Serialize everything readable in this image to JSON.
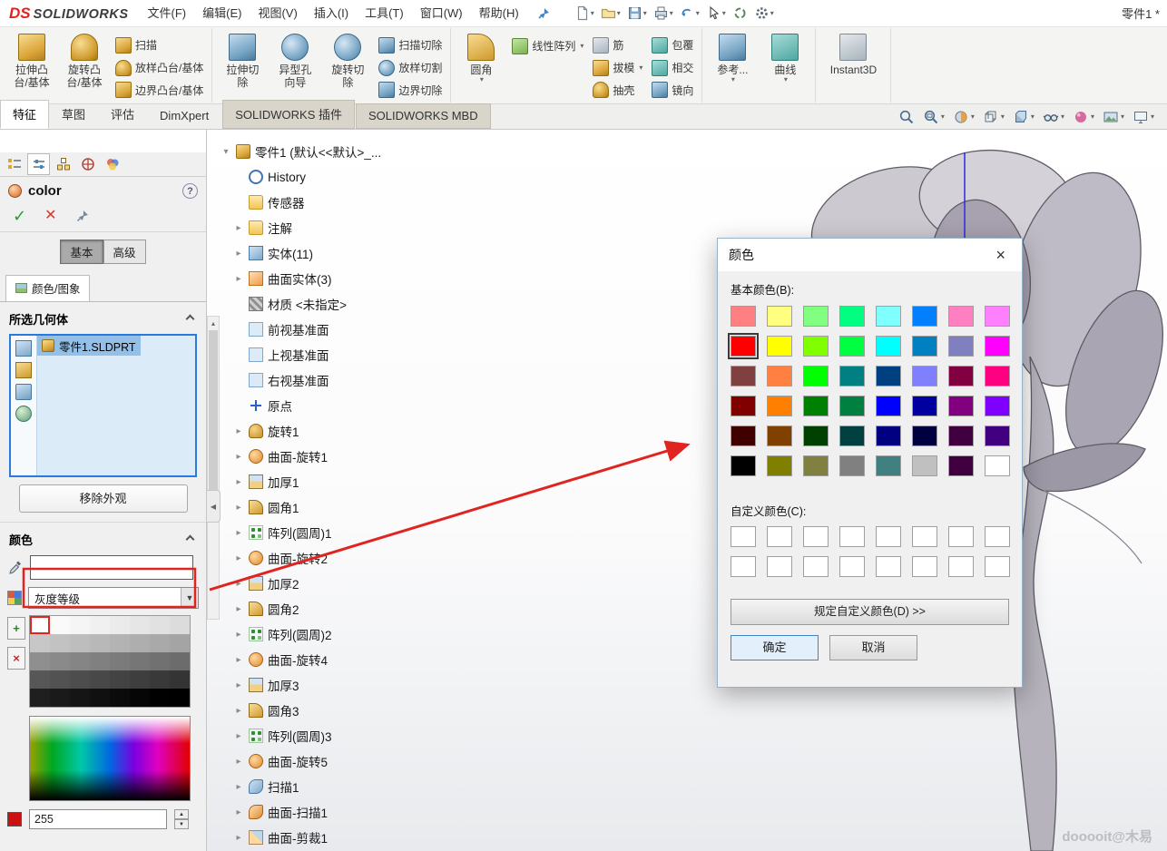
{
  "app": {
    "logo_ds": "DS",
    "logo_name": "SOLIDWORKS",
    "doc_title": "零件1 *",
    "watermark": "dooooit@木易"
  },
  "colors": {
    "annotation_red": "#e02420",
    "selection_blue": "#2a7ade",
    "logo_red": "#e2231a"
  },
  "icons": {
    "caret_down": "▾",
    "expander": "▸",
    "check": "✓",
    "cross": "✕",
    "close": "×",
    "help": "?",
    "collapse_left": "◀",
    "spin_up": "▲",
    "spin_down": "▼",
    "scroll_up": "▴",
    "plus": "+",
    "delete": "×"
  },
  "menubar": {
    "items": [
      "文件(F)",
      "编辑(E)",
      "视图(V)",
      "插入(I)",
      "工具(T)",
      "窗口(W)",
      "帮助(H)"
    ]
  },
  "ribbon": {
    "g1_big": [
      [
        "拉伸凸",
        "台/基体"
      ],
      [
        "旋转凸",
        "台/基体"
      ]
    ],
    "g1_small": [
      "扫描",
      "放样凸台/基体",
      "边界凸台/基体"
    ],
    "g2_big": [
      [
        "拉伸切",
        "除"
      ],
      [
        "异型孔",
        "向导"
      ],
      [
        "旋转切",
        "除"
      ]
    ],
    "g2_small": [
      "扫描切除",
      "放样切割",
      "边界切除"
    ],
    "g3_big": [
      [
        "圆角",
        ""
      ]
    ],
    "g3_small1": [
      "线性阵列"
    ],
    "g3_small2": [
      "筋",
      "拔模",
      "抽壳"
    ],
    "g3_small3": [
      "包覆",
      "相交",
      "镜向"
    ],
    "g4_big": [
      [
        "参考...",
        ""
      ],
      [
        "曲线",
        ""
      ]
    ],
    "g5_big": [
      [
        "Instant3D",
        ""
      ]
    ]
  },
  "tabs": {
    "items": [
      "特征",
      "草图",
      "评估",
      "DimXpert",
      "SOLIDWORKS 插件",
      "SOLIDWORKS MBD"
    ],
    "active": "特征"
  },
  "feature_tree": {
    "root": {
      "label": "零件1 (默认<<默认>_...",
      "icon": "part"
    },
    "items": [
      {
        "label": "History",
        "icon": "history",
        "expand": false
      },
      {
        "label": "传感器",
        "icon": "sensors",
        "expand": false
      },
      {
        "label": "注解",
        "icon": "annotations",
        "expand": true
      },
      {
        "label": "实体(11)",
        "icon": "solid-folder",
        "expand": true
      },
      {
        "label": "曲面实体(3)",
        "icon": "surface-folder",
        "expand": true
      },
      {
        "label": "材质 <未指定>",
        "icon": "material",
        "expand": false
      },
      {
        "label": "前视基准面",
        "icon": "plane",
        "expand": false
      },
      {
        "label": "上视基准面",
        "icon": "plane",
        "expand": false
      },
      {
        "label": "右视基准面",
        "icon": "plane",
        "expand": false
      },
      {
        "label": "原点",
        "icon": "origin",
        "expand": false
      },
      {
        "label": "旋转1",
        "icon": "revolve",
        "expand": true
      },
      {
        "label": "曲面-旋转1",
        "icon": "surface-revolve",
        "expand": true
      },
      {
        "label": "加厚1",
        "icon": "thicken",
        "expand": true
      },
      {
        "label": "圆角1",
        "icon": "fillet",
        "expand": true
      },
      {
        "label": "阵列(圆周)1",
        "icon": "circular-pattern",
        "expand": true
      },
      {
        "label": "曲面-旋转2",
        "icon": "surface-revolve",
        "expand": true
      },
      {
        "label": "加厚2",
        "icon": "thicken",
        "expand": true
      },
      {
        "label": "圆角2",
        "icon": "fillet",
        "expand": true
      },
      {
        "label": "阵列(圆周)2",
        "icon": "circular-pattern",
        "expand": true
      },
      {
        "label": "曲面-旋转4",
        "icon": "surface-revolve",
        "expand": true
      },
      {
        "label": "加厚3",
        "icon": "thicken",
        "expand": true
      },
      {
        "label": "圆角3",
        "icon": "fillet",
        "expand": true
      },
      {
        "label": "阵列(圆周)3",
        "icon": "circular-pattern",
        "expand": true
      },
      {
        "label": "曲面-旋转5",
        "icon": "surface-revolve",
        "expand": true
      },
      {
        "label": "扫描1",
        "icon": "sweep",
        "expand": true
      },
      {
        "label": "曲面-扫描1",
        "icon": "surface-sweep",
        "expand": true
      },
      {
        "label": "曲面-剪裁1",
        "icon": "surface-trim",
        "expand": true
      }
    ]
  },
  "property_panel": {
    "title": "color",
    "mode_basic": "基本",
    "mode_advanced": "高级",
    "page_tab": "颜色/图象",
    "selected_geometry_header": "所选几何体",
    "selected_item": "零件1.SLDPRT",
    "remove_appearance": "移除外观",
    "color_header": "颜色",
    "color_value": "",
    "gray_dropdown": "灰度等级",
    "rgb_value": "255",
    "palette": {
      "rows": 5,
      "cols": 8
    }
  },
  "dialog": {
    "title": "颜色",
    "basic_label": "基本颜色(B):",
    "custom_label": "自定义颜色(C):",
    "define_button": "规定自定义颜色(D) >>",
    "ok": "确定",
    "cancel": "取消",
    "selected_index": 8,
    "basic_colors": [
      "#FF8080",
      "#FFFF80",
      "#80FF80",
      "#00FF80",
      "#80FFFF",
      "#0080FF",
      "#FF80C0",
      "#FF80FF",
      "#FF0000",
      "#FFFF00",
      "#80FF00",
      "#00FF40",
      "#00FFFF",
      "#0080C0",
      "#8080C0",
      "#FF00FF",
      "#804040",
      "#FF8040",
      "#00FF00",
      "#008080",
      "#004080",
      "#8080FF",
      "#800040",
      "#FF0080",
      "#800000",
      "#FF8000",
      "#008000",
      "#008040",
      "#0000FF",
      "#0000A0",
      "#800080",
      "#8000FF",
      "#400000",
      "#804000",
      "#004000",
      "#004040",
      "#000080",
      "#000040",
      "#400040",
      "#400080",
      "#000000",
      "#808000",
      "#808040",
      "#808080",
      "#408080",
      "#C0C0C0",
      "#400040",
      "#FFFFFF"
    ],
    "custom_colors": [
      "#FFFFFF",
      "#FFFFFF",
      "#FFFFFF",
      "#FFFFFF",
      "#FFFFFF",
      "#FFFFFF",
      "#FFFFFF",
      "#FFFFFF",
      "#FFFFFF",
      "#FFFFFF",
      "#FFFFFF",
      "#FFFFFF",
      "#FFFFFF",
      "#FFFFFF",
      "#FFFFFF",
      "#FFFFFF"
    ]
  }
}
